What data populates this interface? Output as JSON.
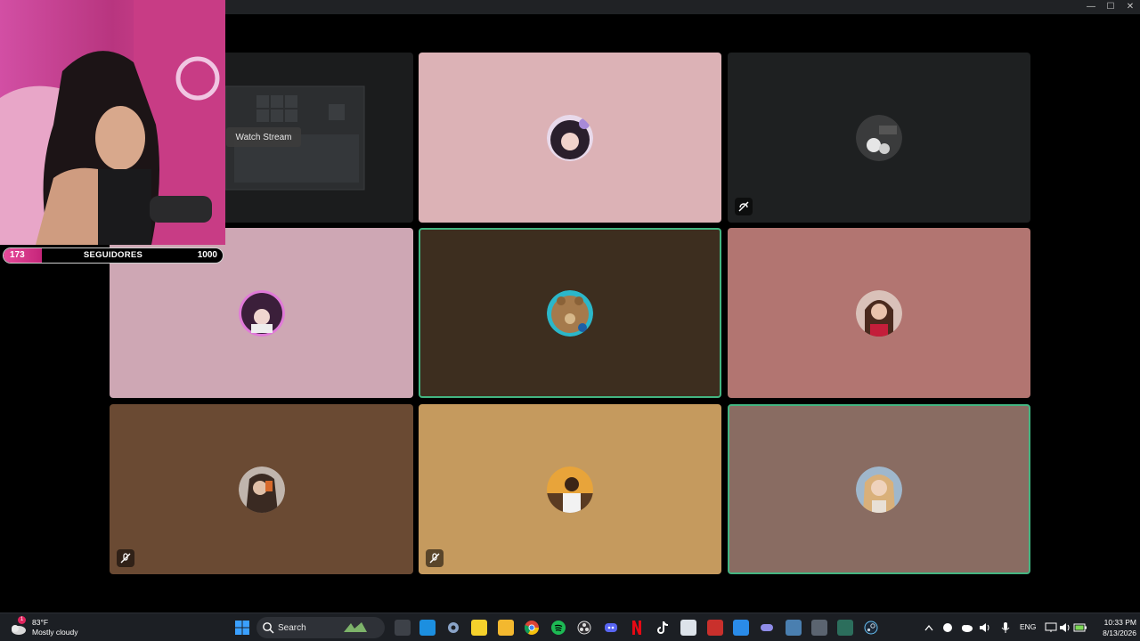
{
  "window": {
    "controls": {
      "minimize": "—",
      "maximize": "☐",
      "close": "✕"
    }
  },
  "stage": {
    "stream_tile": {
      "watch_label": "Watch Stream"
    },
    "tiles": [
      {
        "bg": "#dcb2b6",
        "speaking": false,
        "muted": false,
        "avatar": "avatar-user-1"
      },
      {
        "bg": "#1e2021",
        "speaking": false,
        "muted": true,
        "avatar": "avatar-user-2"
      },
      {
        "bg": "#cea7b4",
        "speaking": false,
        "muted": false,
        "avatar": "avatar-user-3"
      },
      {
        "bg": "#3d2e1f",
        "speaking": true,
        "muted": false,
        "avatar": "avatar-user-4"
      },
      {
        "bg": "#b27571",
        "speaking": false,
        "muted": false,
        "avatar": "avatar-user-5"
      },
      {
        "bg": "#6a4a33",
        "speaking": false,
        "muted": true,
        "avatar": "avatar-user-6"
      },
      {
        "bg": "#c59a5e",
        "speaking": false,
        "muted": true,
        "avatar": "avatar-user-7"
      },
      {
        "bg": "#896c62",
        "speaking": true,
        "muted": false,
        "avatar": "avatar-user-8"
      }
    ]
  },
  "overlay": {
    "followers": {
      "current": "173",
      "label": "SEGUIDORES",
      "goal": "1000",
      "progress": 0.173
    }
  },
  "taskbar": {
    "weather": {
      "temp": "83°F",
      "condition": "Mostly cloudy",
      "badge": "1"
    },
    "search_placeholder": "Search",
    "tray_lang": "ENG",
    "clock": {
      "time": "10:33 PM",
      "date": "8/13/2026"
    }
  },
  "colors": {
    "speaking_border": "#43b581",
    "titlebar": "#202225",
    "taskbar": "#1c1f24"
  }
}
